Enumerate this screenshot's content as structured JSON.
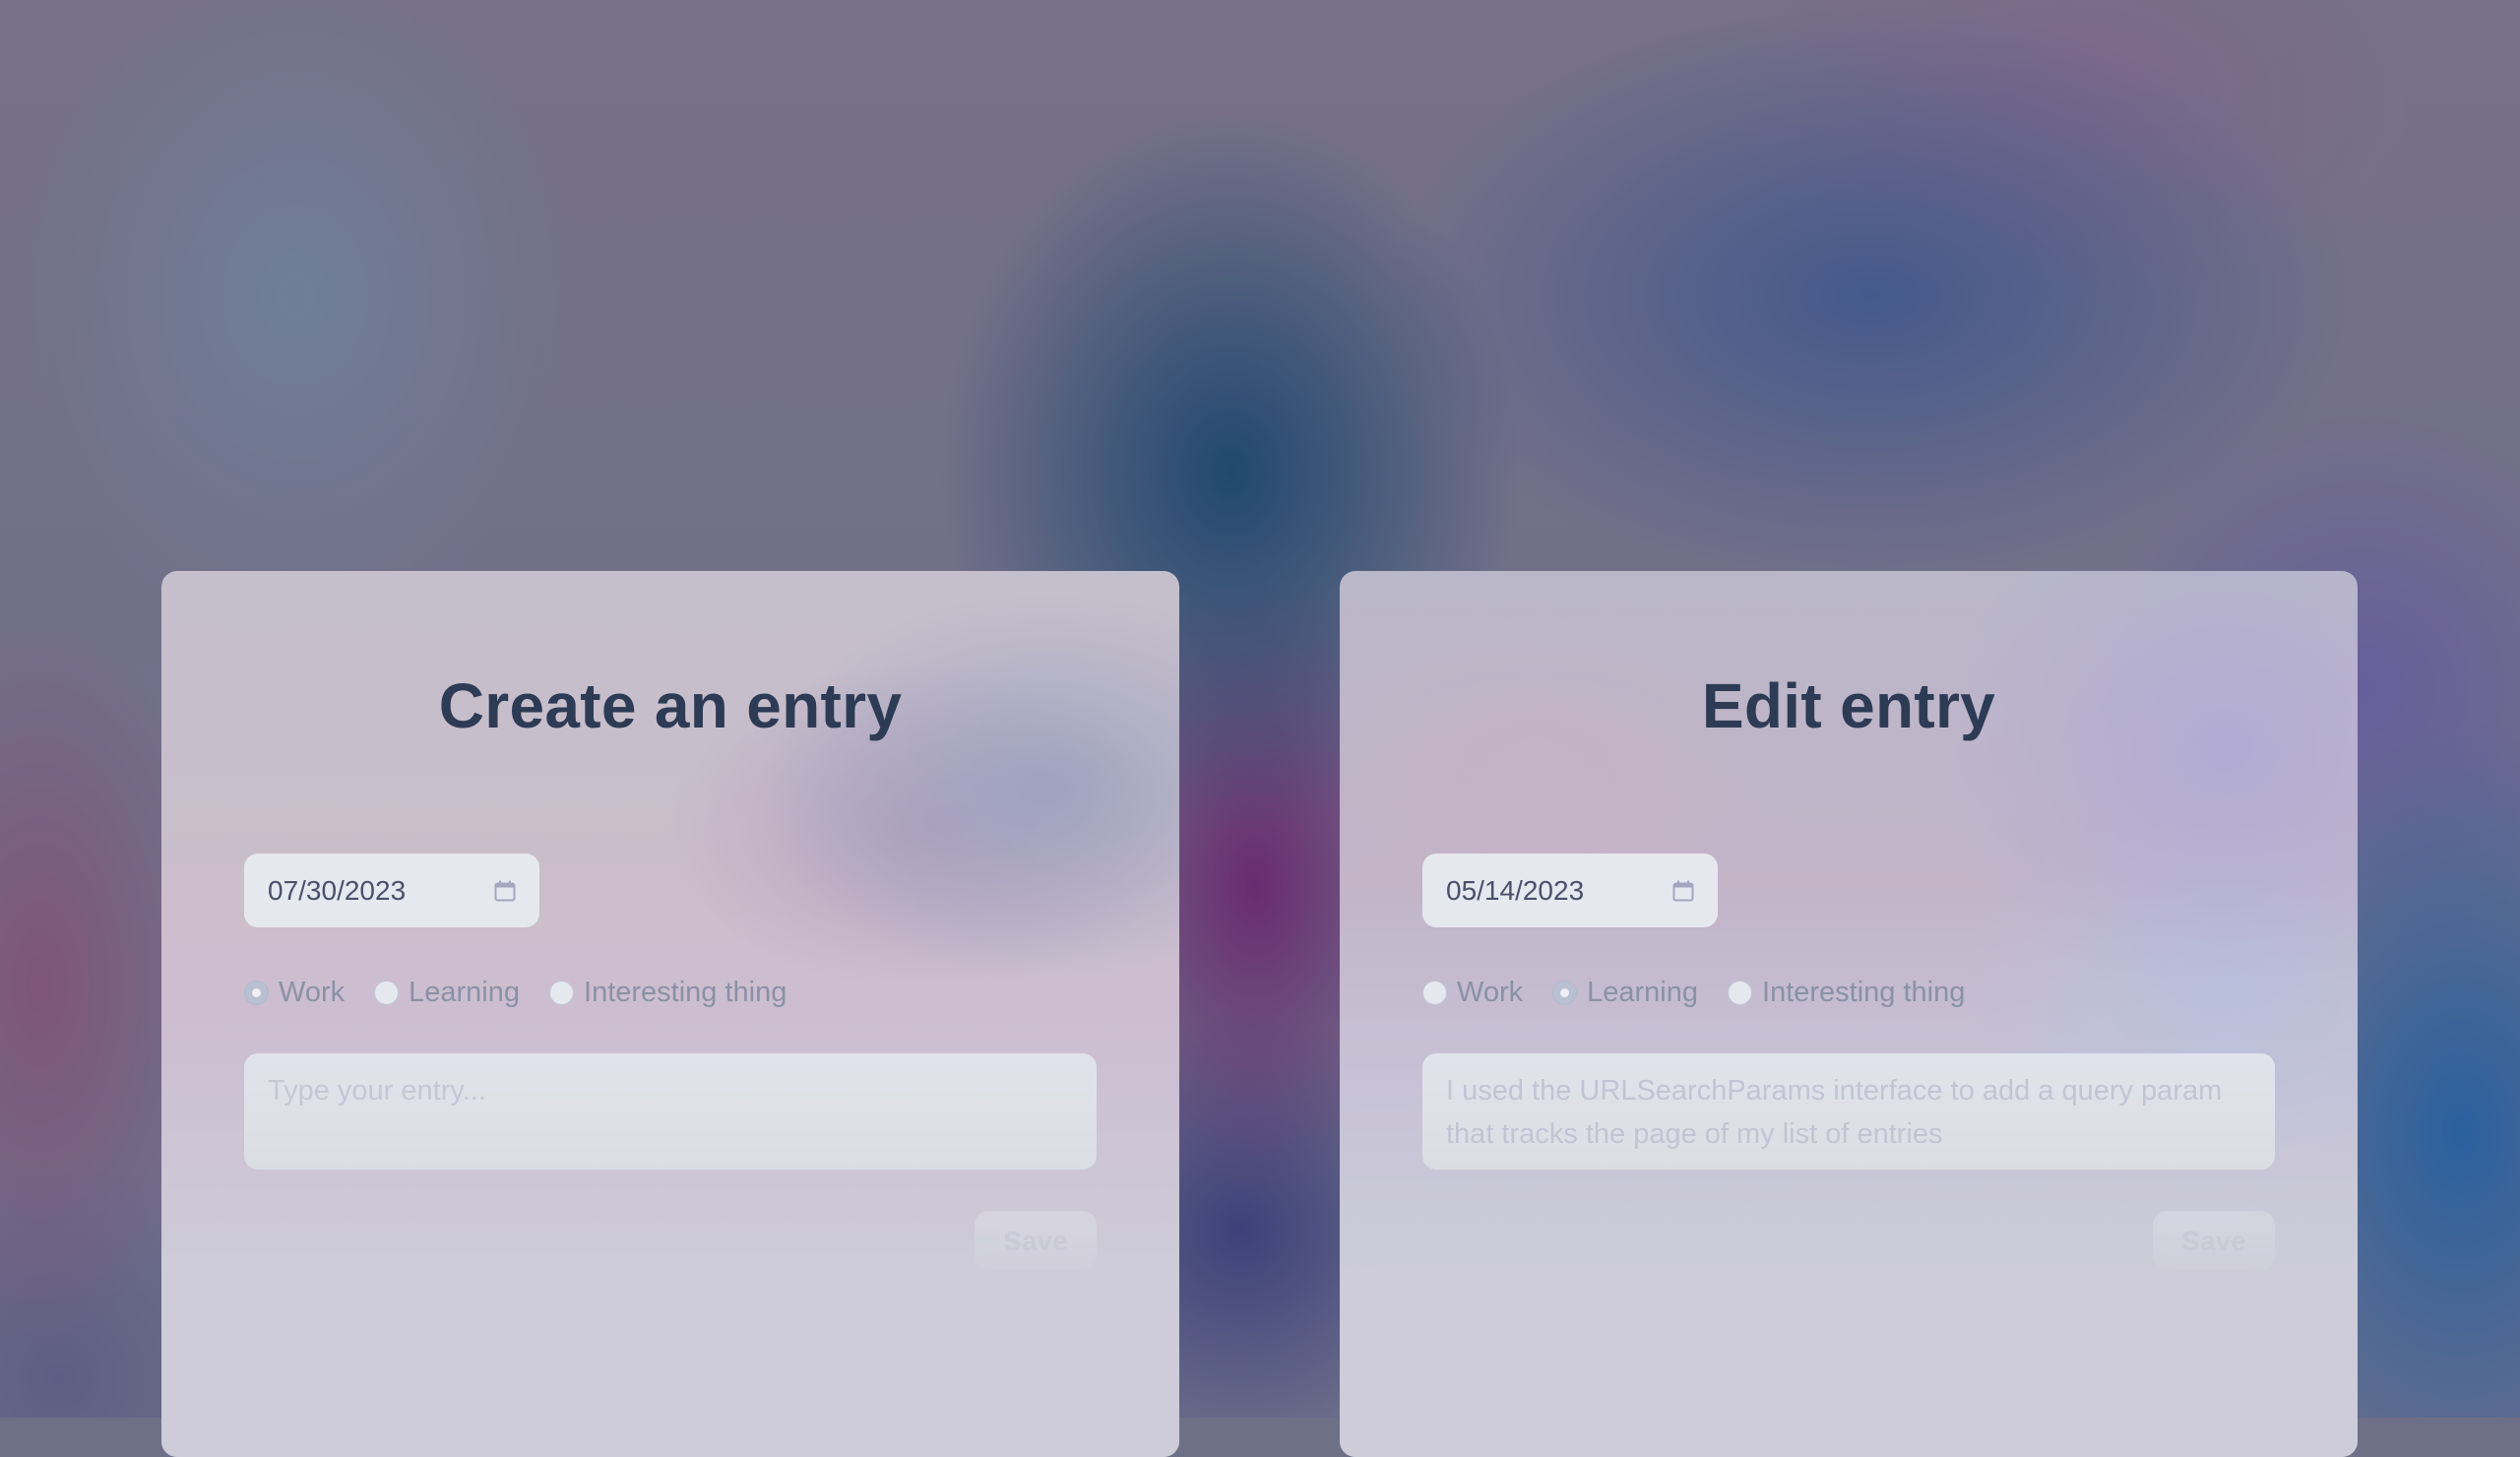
{
  "create_card": {
    "title": "Create an entry",
    "date_value": "07/30/2023",
    "date_icon": "calendar-icon",
    "categories": [
      {
        "label": "Work",
        "checked": true
      },
      {
        "label": "Learning",
        "checked": false
      },
      {
        "label": "Interesting thing",
        "checked": false
      }
    ],
    "entry_value": "",
    "entry_placeholder": "Type your entry...",
    "save_label": "Save"
  },
  "edit_card": {
    "title": "Edit entry",
    "date_value": "05/14/2023",
    "date_icon": "calendar-icon",
    "categories": [
      {
        "label": "Work",
        "checked": false
      },
      {
        "label": "Learning",
        "checked": true
      },
      {
        "label": "Interesting thing",
        "checked": false
      }
    ],
    "entry_value": "I used the URLSearchParams interface to add a query param that tracks the page of my list of entries",
    "entry_placeholder": "",
    "save_label": "Save"
  },
  "colors": {
    "title": "#2d3b55",
    "field_bg": "#e6e8f0",
    "radio_checked": "#b9c0d2",
    "label": "#8a91a4",
    "card_bg": "#cdccd8"
  }
}
